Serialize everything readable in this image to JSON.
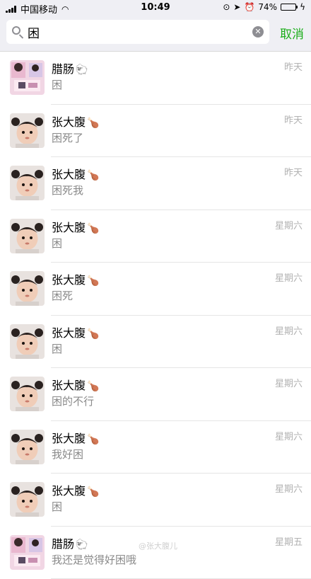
{
  "status_bar": {
    "carrier": "中国移动",
    "time": "10:49",
    "battery": "74%",
    "battery_level": 0.74
  },
  "search": {
    "query": "困",
    "cancel_label": "取消"
  },
  "results": [
    {
      "name": "腊肠",
      "emoji": "🐑",
      "message": "困",
      "time": "昨天",
      "avatar": "group"
    },
    {
      "name": "张大腹",
      "emoji": "🍗",
      "message": "困死了",
      "time": "昨天",
      "avatar": "baby"
    },
    {
      "name": "张大腹",
      "emoji": "🍗",
      "message": "困死我",
      "time": "昨天",
      "avatar": "baby"
    },
    {
      "name": "张大腹",
      "emoji": "🍗",
      "message": "困",
      "time": "星期六",
      "avatar": "baby"
    },
    {
      "name": "张大腹",
      "emoji": "🍗",
      "message": "困死",
      "time": "星期六",
      "avatar": "baby"
    },
    {
      "name": "张大腹",
      "emoji": "🍗",
      "message": "困",
      "time": "星期六",
      "avatar": "baby"
    },
    {
      "name": "张大腹",
      "emoji": "🍗",
      "message": "困的不行",
      "time": "星期六",
      "avatar": "baby"
    },
    {
      "name": "张大腹",
      "emoji": "🍗",
      "message": "我好困",
      "time": "星期六",
      "avatar": "baby"
    },
    {
      "name": "张大腹",
      "emoji": "🍗",
      "message": "困",
      "time": "星期六",
      "avatar": "baby"
    },
    {
      "name": "腊肠",
      "emoji": "🐑",
      "message": "我还是觉得好困哦",
      "time": "星期五",
      "avatar": "group"
    }
  ],
  "watermark": "@张大腹儿"
}
